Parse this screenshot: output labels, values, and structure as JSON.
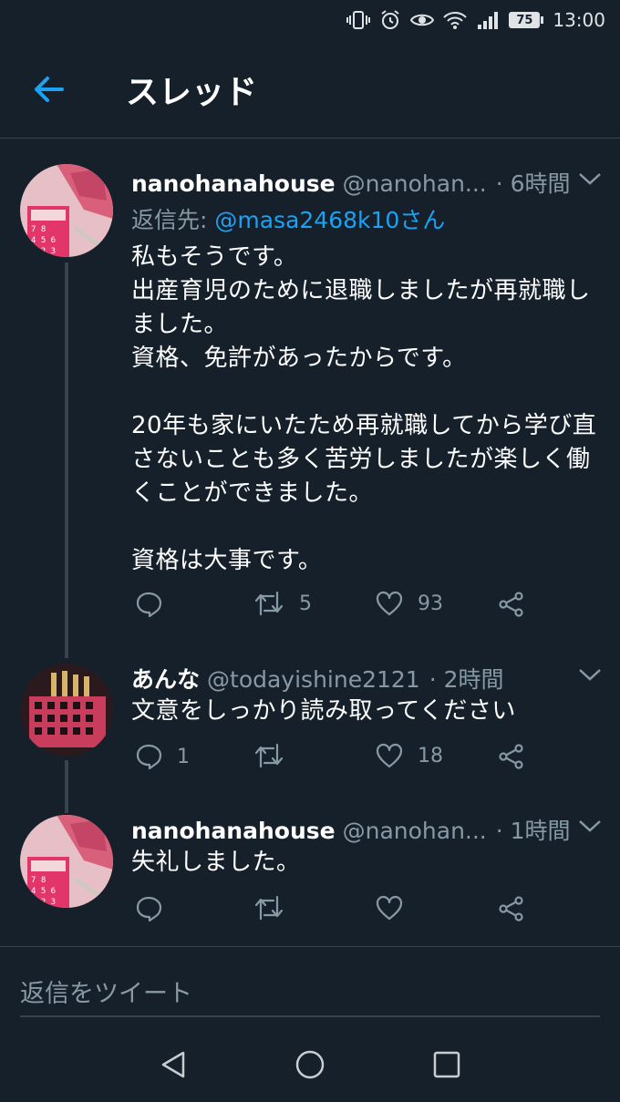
{
  "status_bar": {
    "battery": "75",
    "time": "13:00"
  },
  "header": {
    "title": "スレッド"
  },
  "tweets": [
    {
      "name": "nanohanahouse",
      "handle": "@nanohan...",
      "time": "· 6時間",
      "reply_prefix": "返信先: ",
      "reply_to": "@masa2468k10さん",
      "text": "私もそうです。\n出産育児のために退職しましたが再就職しました。\n資格、免許があったからです。\n\n20年も家にいたため再就職してから学び直さないことも多く苦労しましたが楽しく働くことができました。\n\n資格は大事です。",
      "reply_count": "",
      "retweet_count": "5",
      "like_count": "93"
    },
    {
      "name": "あんな",
      "handle": "@todayishine2121",
      "time": "· 2時間",
      "text": "文意をしっかり読み取ってください",
      "reply_count": "1",
      "retweet_count": "",
      "like_count": "18"
    },
    {
      "name": "nanohanahouse",
      "handle": "@nanohan...",
      "time": "· 1時間",
      "text": "失礼しました。",
      "reply_count": "",
      "retweet_count": "",
      "like_count": ""
    }
  ],
  "compose": {
    "placeholder": "返信をツイート"
  },
  "colors": {
    "background": "#15202b",
    "accent": "#1da1f2",
    "muted": "#8899a6",
    "divider": "#38444d"
  }
}
